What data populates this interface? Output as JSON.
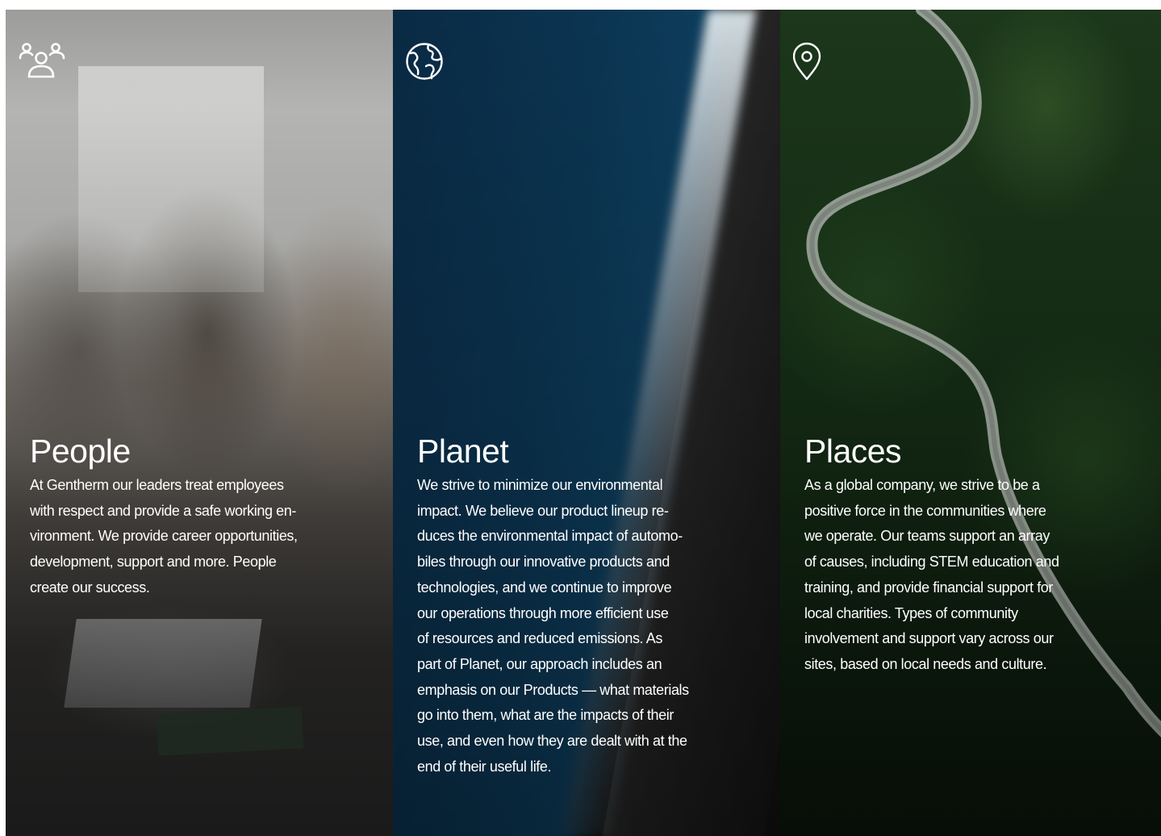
{
  "panels": {
    "people": {
      "icon": "people-group-icon",
      "title": "People",
      "body_lines": [
        "At Gentherm our leaders treat employees",
        "with respect and provide a safe working en-",
        "vironment. We provide career opportunities,",
        "development, support and more. People",
        "create our success."
      ]
    },
    "planet": {
      "icon": "globe-icon",
      "title": "Planet",
      "body_lines": [
        "We strive to minimize our environmental",
        "impact. We believe our product lineup re-",
        "duces the environmental impact of automo-",
        "biles through our innovative products and",
        "technologies, and we continue to improve",
        "our operations through more efficient use",
        "of resources and reduced emissions.  As",
        "part of Planet, our approach includes an",
        "emphasis on our Products — what materials",
        "go into them, what are the impacts of their",
        "use, and even how they are dealt with at the",
        "end of their useful life."
      ]
    },
    "places": {
      "icon": "location-pin-icon",
      "title": "Places",
      "body_lines": [
        "As a global company, we strive to be a",
        "positive force in the communities where",
        "we operate. Our teams support an array",
        "of causes, including STEM education and",
        "training, and provide financial support for",
        "local charities. Types of community",
        "involvement and support vary across our",
        "sites, based on local needs and culture."
      ]
    }
  },
  "colors": {
    "text": "#ffffff",
    "ocean": "#0b3552",
    "forest": "#183218"
  }
}
